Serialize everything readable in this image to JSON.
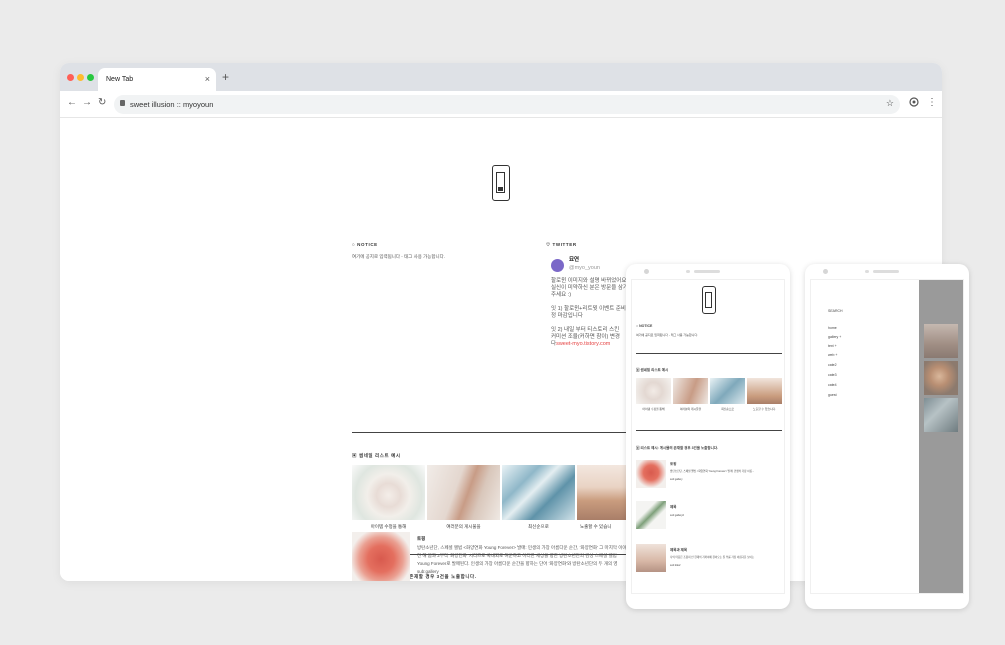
{
  "browser": {
    "tab_title": "New Tab",
    "new_tab_symbol": "+",
    "tab_close_symbol": "×",
    "address": "sweet illusion :: myoyoun",
    "icons": [
      "back-icon",
      "forward-icon",
      "reload-icon",
      "lock-icon",
      "star-icon",
      "extension-icon",
      "more-icon"
    ],
    "traffic_light_colors": [
      "#ff5f57",
      "#febc2e",
      "#28c840"
    ]
  },
  "blog": {
    "notice": {
      "title": "NOTICE",
      "text": "여기에 공지로 입력됩니다 - 태그 사용 가능합니다."
    },
    "twitter": {
      "title": "TWITTER",
      "name": "묘연",
      "handle": "@myo_youn",
      "lines": [
        "할로윈 이미지와 설명 바뀌었어요",
        "실신이 미약하신 분은 방문을 삼가",
        "주세요 :)",
        "",
        "잇 1) 할로윈+리트윗 이벤트 준비",
        "정 마감입니다",
        "",
        "잇 2) 내일 부터 티스토리 스킨",
        "커미션 조율(커하면 참이) 변경",
        "다"
      ],
      "link": "sweet-myo.tistory.com"
    },
    "gallery": {
      "title": "썸네일 리스트 예시",
      "items": [
        {
          "caption": "아이템 수정을 통해"
        },
        {
          "caption": "여러분의 게시물을"
        },
        {
          "caption": "최신순으로"
        },
        {
          "caption": "노출할 수 있습니"
        }
      ]
    },
    "list": {
      "title": "리스트 예시: 게시물의 존재할 경우 3건을 노출합니다.",
      "first": {
        "title": "토핑",
        "lines": [
          "방탄소년단, 스페셜 앨범 <화양연화 Young Forever> 발매: 민생의 가장 아름다운 순간, '화양연화' 그 마지막 이야기",
          "전 해 봄과 2부작 '화양연화' 시리즈로 국내외로 여운하고 이러한 세상을 향한 방탄소년단의 감성 스페셜 앨범",
          "Young Forever로 발매된다. 인생의 가장 아름다운 순간을 향하는 단어 '화양연화'와 방탄소년단의 두 개의 영",
          "sub:gallery"
        ]
      }
    }
  },
  "phone_left": {
    "notice_title": "NOTICE",
    "notice_text": "여기에 공지로 입력됩니다 - 태그 사용 가능합니다.",
    "gallery_title": "썸네일 리스트 예시",
    "gallery_captions": [
      "아이템 수정을 통해",
      "여러분의 게시물을",
      "최신순으로",
      "노출할 수 있습니다."
    ],
    "list_title": "리스트 예시: 게시물의 존재할 경우 3건을 노출합니다.",
    "posts": [
      {
        "title": "토핑",
        "text": "방탄소년단, 스페셜 앨범 <화양연화 Young Forever> 발매: 민생의 가장 아름...",
        "sub": "sub:gallery"
      },
      {
        "title": "제목",
        "text": "",
        "sub": "sub:gallery2"
      },
      {
        "title": "제목과 제목",
        "text": "나의 마음은 조용히 안 현재의 가까이에 걸어오는 길 부를 가장 아름다운 보이는",
        "sub": "sub:title2"
      }
    ]
  },
  "phone_right": {
    "search_label": "SEARCH",
    "menu": [
      "home",
      "gallery +",
      "text +",
      "web +",
      "cate2",
      "cate3",
      "cate4",
      "guest"
    ]
  }
}
